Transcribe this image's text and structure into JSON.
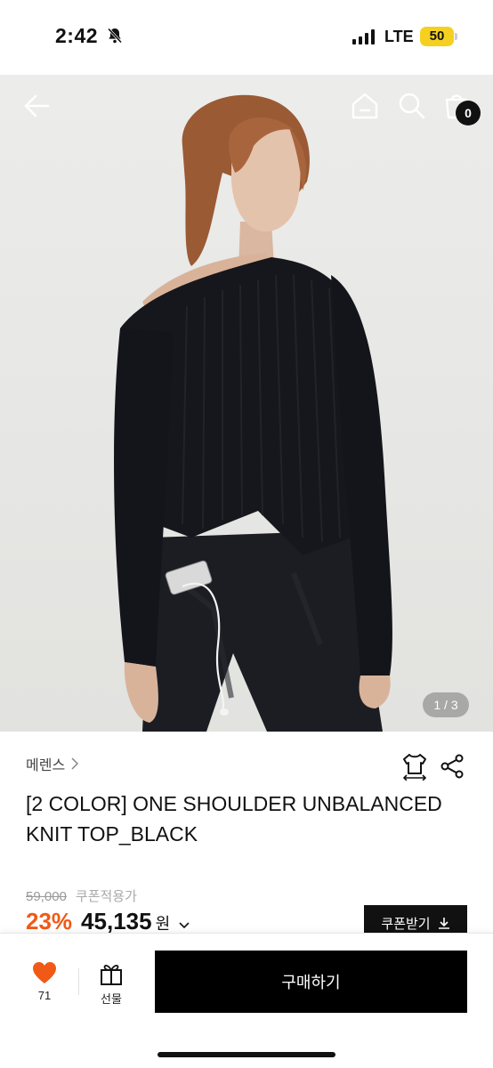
{
  "status_bar": {
    "time": "2:42",
    "network": "LTE",
    "battery": "50"
  },
  "hero": {
    "pager": "1 / 3",
    "cart_count": "0",
    "icons": [
      "back-arrow-icon",
      "home-icon",
      "search-icon",
      "cart-icon"
    ]
  },
  "product": {
    "brand": "메렌스",
    "title": "[2 COLOR] ONE SHOULDER UNBALANCED KNIT TOP_BLACK",
    "original_price": "59,000",
    "coupon_note": "쿠폰적용가",
    "discount": "23%",
    "price": "45,135",
    "currency": "원",
    "coupon_button": "쿠폰받기"
  },
  "bottom_bar": {
    "like_count": "71",
    "gift_label": "선물",
    "buy_label": "구매하기"
  },
  "colors": {
    "accent_orange": "#f05a16",
    "like_heart": "#f05a16",
    "battery": "#f5d020",
    "black": "#000000"
  }
}
